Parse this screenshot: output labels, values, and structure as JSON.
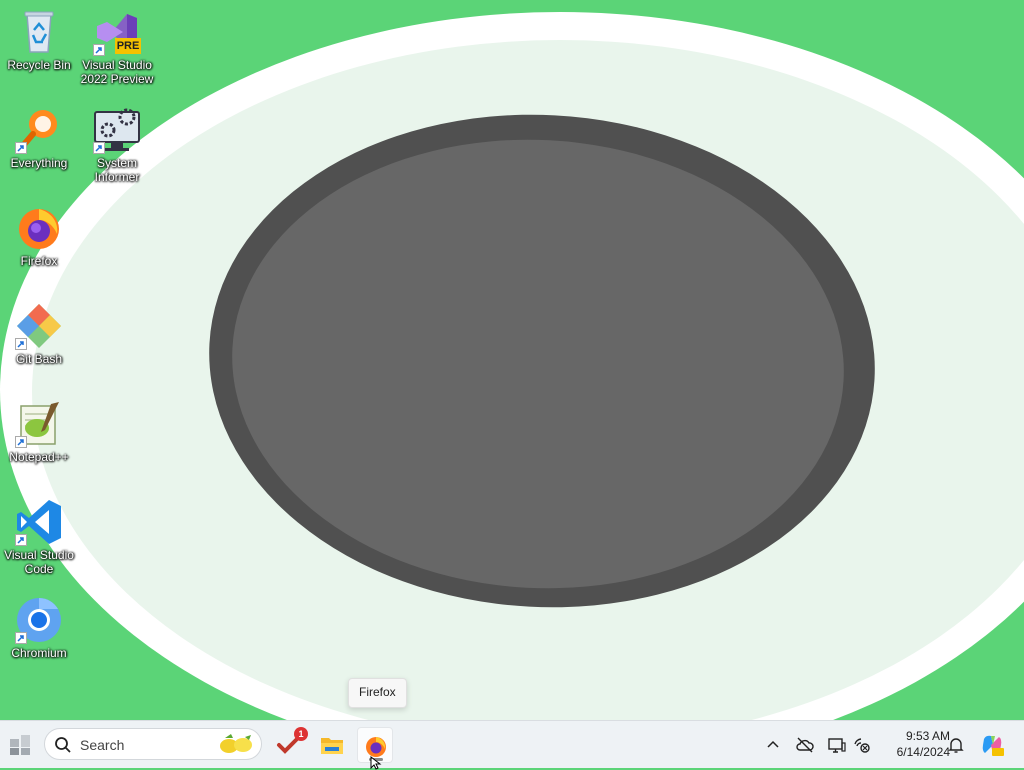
{
  "desktop": {
    "icons": [
      {
        "label": "Recycle Bin",
        "icon": "recycle-bin-icon"
      },
      {
        "label": "Visual Studio 2022 Preview",
        "icon": "visual-studio-preview-icon",
        "badge": "PRE"
      },
      {
        "label": "Everything",
        "icon": "everything-search-icon"
      },
      {
        "label": "System Informer",
        "icon": "system-informer-icon"
      },
      {
        "label": "Firefox",
        "icon": "firefox-icon"
      },
      {
        "label": "Git Bash",
        "icon": "git-bash-icon"
      },
      {
        "label": "Notepad++",
        "icon": "notepad-plus-plus-icon"
      },
      {
        "label": "Visual Studio Code",
        "icon": "vscode-icon"
      },
      {
        "label": "Chromium",
        "icon": "chromium-icon"
      }
    ]
  },
  "tooltip": {
    "text": "Firefox"
  },
  "taskbar": {
    "search": {
      "placeholder": "Search"
    },
    "task_badge_count": "1",
    "clock": {
      "time": "9:53 AM",
      "date": "6/14/2024"
    }
  },
  "colors": {
    "wallpaper_green": "#5bd477",
    "ring_white": "#ffffff",
    "inner_light": "#e9f5ec",
    "disc_outer": "#505050",
    "disc_inner": "#676767",
    "taskbar_bg": "#eef2f5"
  }
}
